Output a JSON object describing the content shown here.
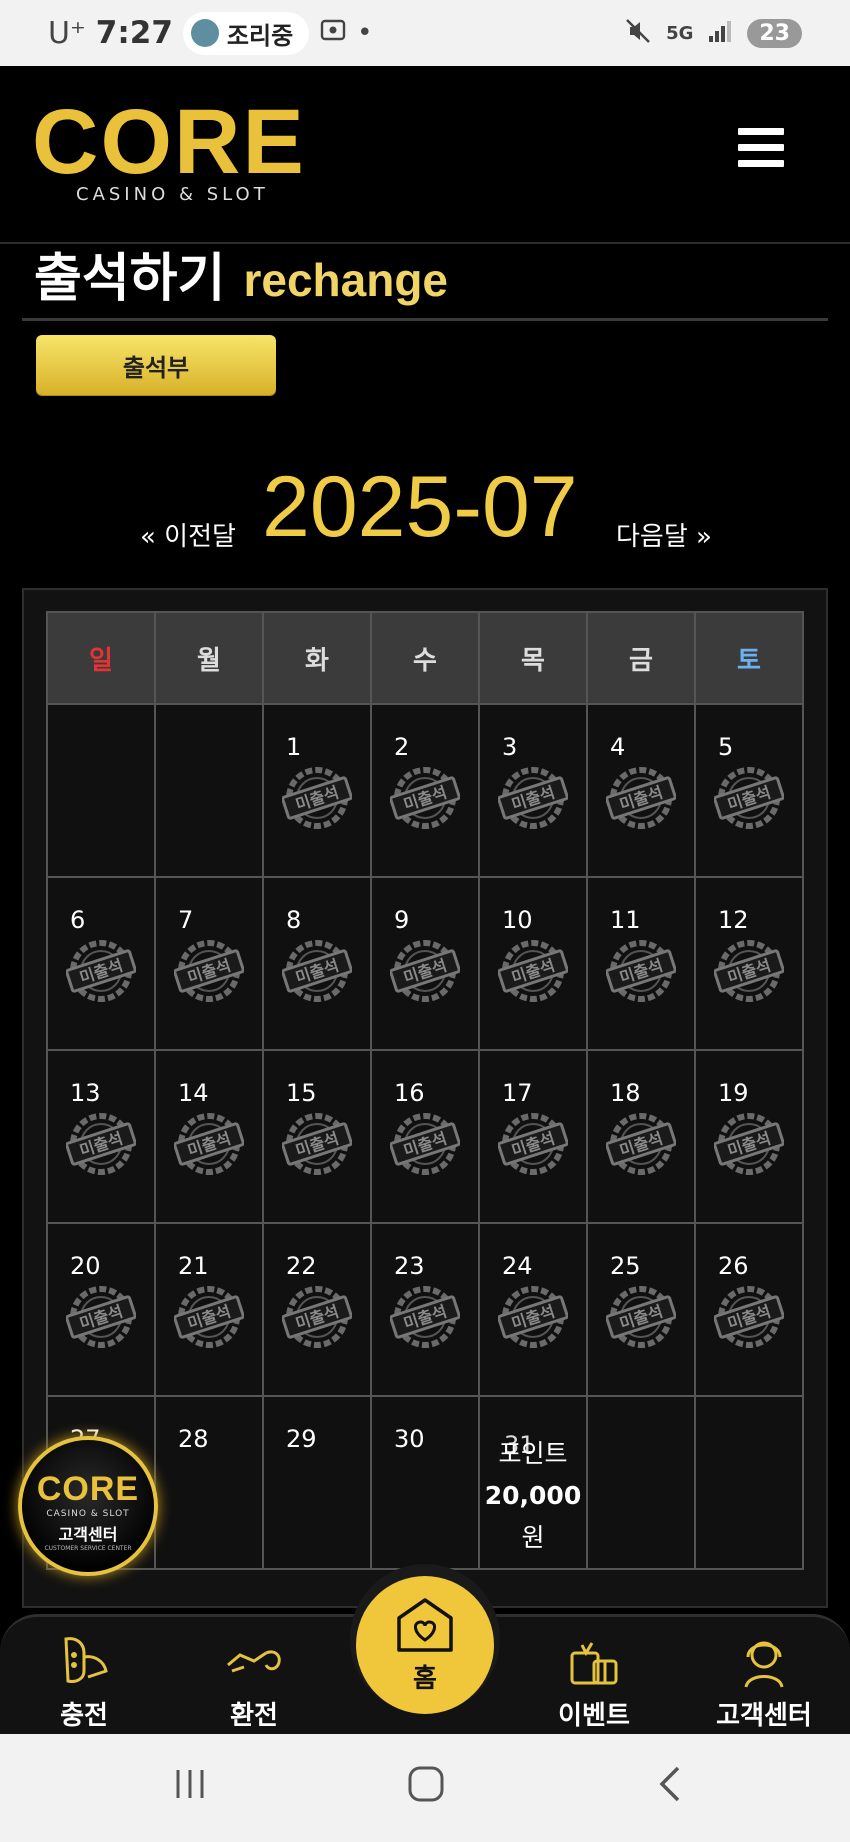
{
  "status_bar": {
    "carrier": "U⁺",
    "time": "7:27",
    "notification_pill": "조리중",
    "network": "5G",
    "battery": "23"
  },
  "header": {
    "logo_main": "CORE",
    "logo_sub": "CASINO & SLOT"
  },
  "page": {
    "title": "출석하기",
    "subtitle": "rechange",
    "attendance_button": "출석부"
  },
  "month_nav": {
    "prev": "« 이전달",
    "current": "2025-07",
    "next": "다음달 »"
  },
  "calendar": {
    "weekdays": [
      "일",
      "월",
      "화",
      "수",
      "목",
      "금",
      "토"
    ],
    "stamp_text": "미출석",
    "weeks": [
      [
        null,
        null,
        "1",
        "2",
        "3",
        "4",
        "5"
      ],
      [
        "6",
        "7",
        "8",
        "9",
        "10",
        "11",
        "12"
      ],
      [
        "13",
        "14",
        "15",
        "16",
        "17",
        "18",
        "19"
      ],
      [
        "20",
        "21",
        "22",
        "23",
        "24",
        "25",
        "26"
      ],
      [
        "27",
        "28",
        "29",
        "30",
        "31",
        null,
        null
      ]
    ],
    "reward": {
      "line1": "포인트",
      "amount": "20,000",
      "unit": "원"
    }
  },
  "floating_support": {
    "logo": "CORE",
    "sub": "CASINO & SLOT",
    "label": "고객센터",
    "tiny": "CUSTOMER SERVICE CENTER"
  },
  "bottom_nav": {
    "charge": "충전",
    "exchange": "환전",
    "home": "홈",
    "event": "이벤트",
    "support": "고객센터"
  },
  "colors": {
    "accent_gold": "#f0cc46",
    "sunday_red": "#e23434",
    "saturday_blue": "#6cb1ef"
  }
}
